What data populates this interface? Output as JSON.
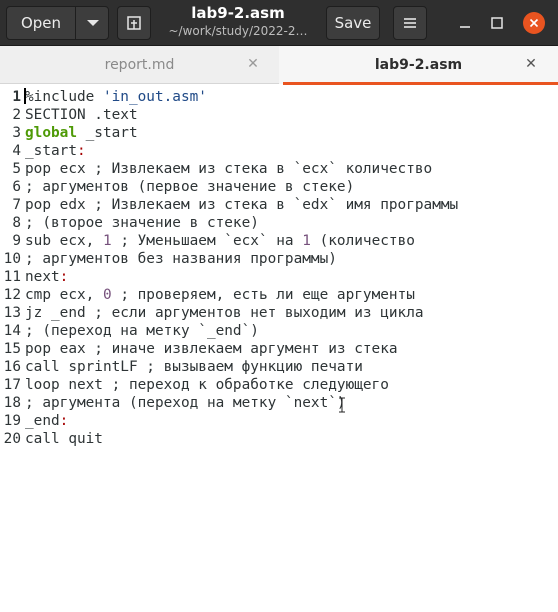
{
  "header": {
    "open_label": "Open",
    "title": "lab9-2.asm",
    "subtitle": "~/work/study/2022-2…",
    "save_label": "Save",
    "icons": [
      "chevron-down-icon",
      "new-document-icon",
      "hamburger-menu-icon",
      "minimize-icon",
      "maximize-icon",
      "close-icon"
    ],
    "close_color": "#e95420"
  },
  "tabs": [
    {
      "label": "report.md",
      "active": false
    },
    {
      "label": "lab9-2.asm",
      "active": true
    }
  ],
  "colors": {
    "accent": "#e95420",
    "keyword": "#4e9a06",
    "string": "#204a87",
    "number": "#75507b"
  },
  "editor": {
    "lines": [
      {
        "n": "1",
        "parts": [
          {
            "t": "%include ",
            "c": "plain"
          },
          {
            "t": "'in_out.asm'",
            "c": "string"
          }
        ]
      },
      {
        "n": "2",
        "parts": [
          {
            "t": "SECTION .text",
            "c": "plain"
          }
        ]
      },
      {
        "n": "3",
        "parts": [
          {
            "t": "global",
            "c": "kw"
          },
          {
            "t": " _start",
            "c": "plain"
          }
        ]
      },
      {
        "n": "4",
        "parts": [
          {
            "t": "_start",
            "c": "plain"
          },
          {
            "t": ":",
            "c": "label"
          }
        ]
      },
      {
        "n": "5",
        "parts": [
          {
            "t": "pop ecx ; Извлекаем из стека в `ecx` количество",
            "c": "plain"
          }
        ]
      },
      {
        "n": "6",
        "parts": [
          {
            "t": "; аргументов (первое значение в стеке)",
            "c": "plain"
          }
        ]
      },
      {
        "n": "7",
        "parts": [
          {
            "t": "pop edx ; Извлекаем из стека в `edx` имя программы",
            "c": "plain"
          }
        ]
      },
      {
        "n": "8",
        "parts": [
          {
            "t": "; (второе значение в стеке)",
            "c": "plain"
          }
        ]
      },
      {
        "n": "9",
        "parts": [
          {
            "t": "sub ecx, ",
            "c": "plain"
          },
          {
            "t": "1",
            "c": "num"
          },
          {
            "t": " ; Уменьшаем `ecx` на ",
            "c": "plain"
          },
          {
            "t": "1",
            "c": "num"
          },
          {
            "t": " (количество",
            "c": "plain"
          }
        ]
      },
      {
        "n": "10",
        "parts": [
          {
            "t": "; аргументов без названия программы)",
            "c": "plain"
          }
        ]
      },
      {
        "n": "11",
        "parts": [
          {
            "t": "next",
            "c": "plain"
          },
          {
            "t": ":",
            "c": "label"
          }
        ]
      },
      {
        "n": "12",
        "parts": [
          {
            "t": "cmp ecx, ",
            "c": "plain"
          },
          {
            "t": "0",
            "c": "num"
          },
          {
            "t": " ; проверяем, есть ли еще аргументы",
            "c": "plain"
          }
        ]
      },
      {
        "n": "13",
        "parts": [
          {
            "t": "jz _end ; если аргументов нет выходим из цикла",
            "c": "plain"
          }
        ]
      },
      {
        "n": "14",
        "parts": [
          {
            "t": "; (переход на метку `_end`)",
            "c": "plain"
          }
        ]
      },
      {
        "n": "15",
        "parts": [
          {
            "t": "pop eax ; иначе извлекаем аргумент из стека",
            "c": "plain"
          }
        ]
      },
      {
        "n": "16",
        "parts": [
          {
            "t": "call sprintLF ; вызываем функцию печати",
            "c": "plain"
          }
        ]
      },
      {
        "n": "17",
        "parts": [
          {
            "t": "loop next ; переход к обработке следующего",
            "c": "plain"
          }
        ]
      },
      {
        "n": "18",
        "parts": [
          {
            "t": "; аргумента (переход на метку `next`)",
            "c": "plain"
          }
        ]
      },
      {
        "n": "19",
        "parts": [
          {
            "t": "_end",
            "c": "plain"
          },
          {
            "t": ":",
            "c": "label"
          }
        ]
      },
      {
        "n": "20",
        "parts": [
          {
            "t": "call quit",
            "c": "plain"
          }
        ]
      }
    ]
  }
}
